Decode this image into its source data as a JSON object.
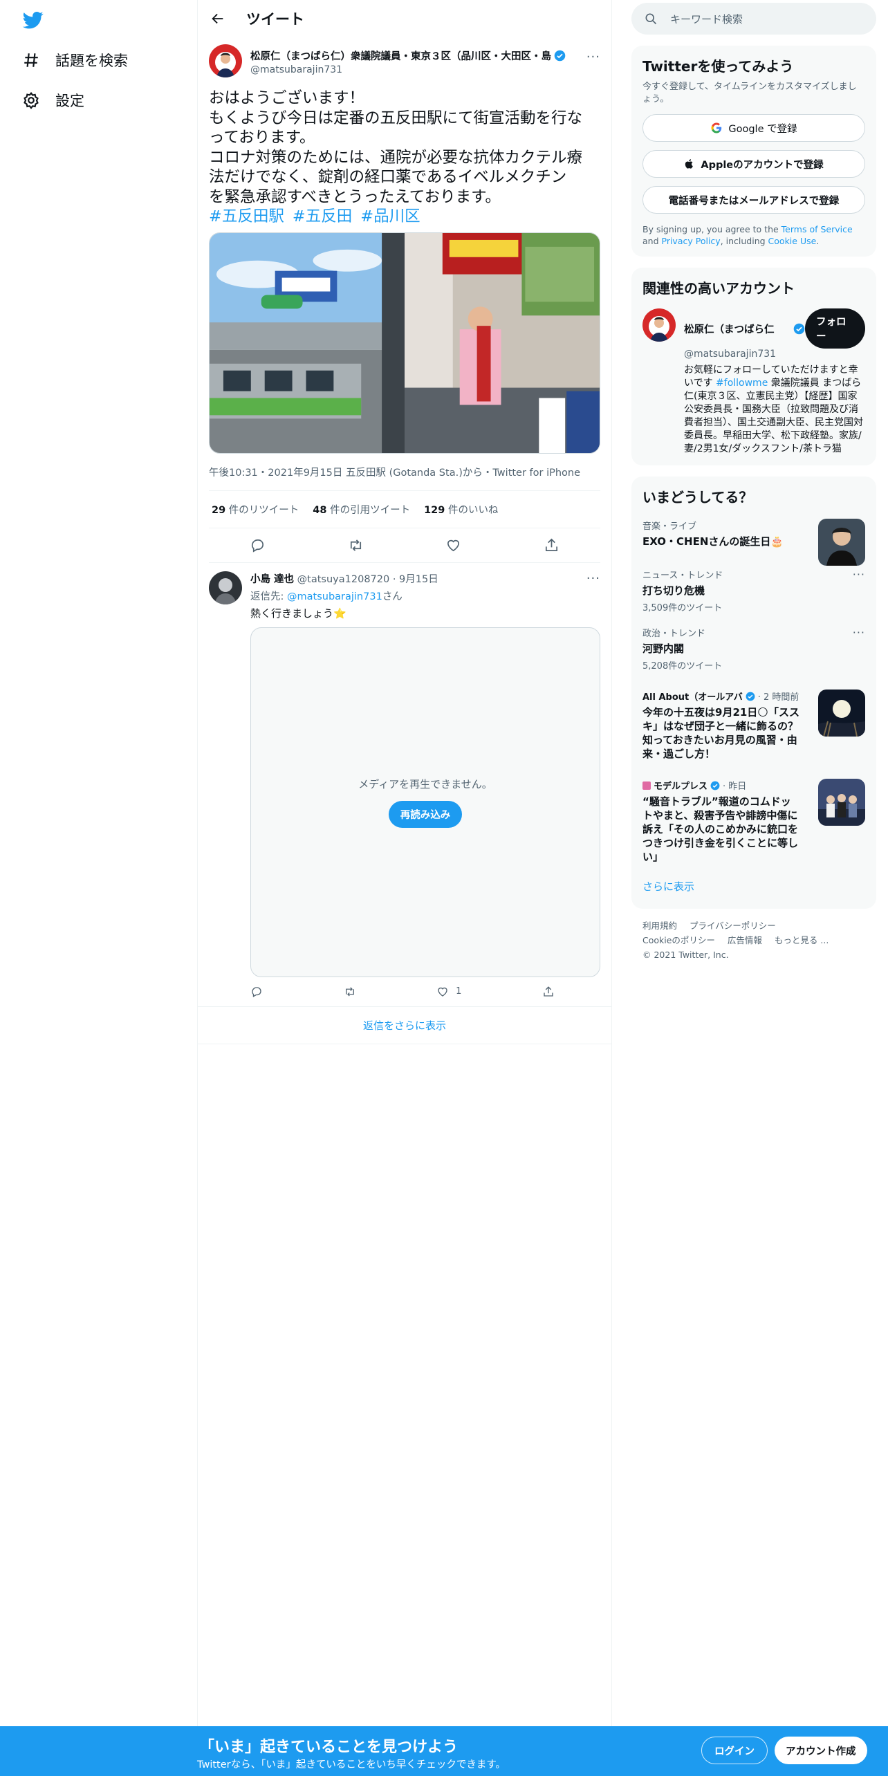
{
  "nav": {
    "explore_label": "話題を検索",
    "settings_label": "設定"
  },
  "header": {
    "title": "ツイート"
  },
  "tweet": {
    "author_name": "松原仁（まつばら仁）衆議院議員・東京３区（品川区・大田区・島",
    "handle": "@matsubarajin731",
    "more": "···",
    "text_lines": [
      "おはようございます！",
      "もくようび今日は定番の五反田駅にて街宣活動を行な",
      "っております。",
      "コロナ対策のためには、通院が必要な抗体カクテル療",
      "法だけでなく、錠剤の経口薬であるイベルメクチン",
      "を緊急承認すべきとうったえております。"
    ],
    "hashtags": [
      "#五反田駅",
      "#五反田",
      "#品川区"
    ],
    "timestamp": "午後10:31・2021年9月15日 五反田駅 (Gotanda Sta.)から・Twitter for iPhone",
    "stats": {
      "retweets_count": "29",
      "retweets_label": "件のリツイート",
      "quotes_count": "48",
      "quotes_label": "件の引用ツイート",
      "likes_count": "129",
      "likes_label": "件のいいね"
    }
  },
  "reply": {
    "author_name": "小島 達也",
    "meta": "@tatsuya1208720 · 9月15日",
    "reply_to_prefix": "返信先: ",
    "reply_to_handle": "@matsubarajin731",
    "reply_to_suffix": "さん",
    "text": "熱く行きましょう⭐",
    "video_message": "メディアを再生できません。",
    "reload_label": "再読み込み",
    "like_count": "1",
    "more": "···"
  },
  "show_more_replies": "返信をさらに表示",
  "search": {
    "placeholder": "キーワード検索"
  },
  "signup_card": {
    "title": "Twitterを使ってみよう",
    "subtitle": "今すぐ登録して、タイムラインをカスタマイズしましょう。",
    "google_label": "Google で登録",
    "apple_label": "Appleのアカウントで登録",
    "phone_label": "電話番号またはメールアドレスで登録",
    "terms_prefix": "By signing up, you agree to the ",
    "terms_link": "Terms of Service",
    "terms_and": " and ",
    "privacy_link": "Privacy Policy",
    "terms_mid": ", including ",
    "cookie_link": "Cookie Use",
    "terms_end": "."
  },
  "related": {
    "title": "関連性の高いアカウント",
    "name": "松原仁（まつばら仁",
    "handle": "@matsubarajin731",
    "follow_label": "フォロー",
    "bio_prefix": "お気軽にフォローしていただけますと幸いです ",
    "bio_hashtag": "#followme",
    "bio_rest": " 衆議院議員 まつばら仁(東京３区、立憲民主党）【経歴】国家公安委員長・国務大臣（拉致問題及び消費者担当）、国土交通副大臣、民主党国対委員長。早稲田大学、松下政経塾。家族/妻/2男1女/ダックスフント/茶トラ猫"
  },
  "trends": {
    "title": "いまどうしてる？",
    "items": [
      {
        "category": "音楽・ライブ",
        "title": "EXO・CHENさんの誕生日🎂"
      },
      {
        "category": "ニュース・トレンド",
        "title": "打ち切り危機",
        "count": "3,509件のツイート",
        "more": "···"
      },
      {
        "category": "政治・トレンド",
        "title": "河野内閣",
        "count": "5,208件のツイート",
        "more": "···"
      },
      {
        "source": "All About（オールアバ",
        "time": "· 2 時間前",
        "title": "今年の十五夜は9月21日🌕「ススキ」はなぜ団子と一緒に飾るの？知っておきたいお月見の風習・由来・過ごし方！"
      },
      {
        "source": "モデルプレス",
        "time": "· 昨日",
        "title": "“騒音トラブル”報道のコムドットやまと、殺害予告や誹謗中傷に訴え「その人のこめかみに銃口をつきつけ引き金を引くことに等しい」"
      }
    ],
    "show_more": "さらに表示"
  },
  "footer": {
    "links_row1": [
      "利用規約",
      "プライバシーポリシー"
    ],
    "links_row2": [
      "Cookieのポリシー",
      "広告情報",
      "もっと見る ..."
    ],
    "copyright": "© 2021 Twitter, Inc."
  },
  "bottom_bar": {
    "title": "「いま」起きていることを見つけよう",
    "subtitle": "Twitterなら、「いま」起きていることをいち早くチェックできます。",
    "login_label": "ログイン",
    "signup_label": "アカウント作成"
  },
  "colors": {
    "accent": "#1d9bf0",
    "text": "#0f1419",
    "muted": "#536471",
    "card_bg": "#f7f9f9"
  }
}
